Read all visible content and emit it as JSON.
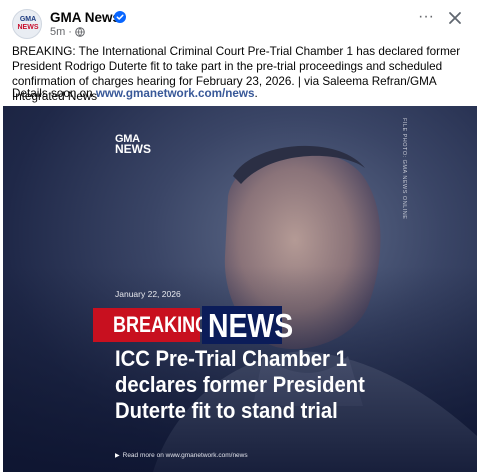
{
  "post": {
    "page_name": "GMA News",
    "time": "5m",
    "privacy_separator": "·",
    "avatar_logo": [
      "GMA",
      "NEWS"
    ],
    "more_label": "···",
    "caption": "BREAKING: The International Criminal Court Pre-Trial Chamber 1 has declared former President Rodrigo Duterte fit to take part in the pre-trial proceedings and scheduled confirmation of charges hearing for February 23, 2026. | via Saleema Refran/GMA Integrated News",
    "details_prefix": "Details soon on ",
    "details_link": "www.gmanetwork.com/news",
    "details_suffix": "."
  },
  "media": {
    "logo_line1": "GMA",
    "logo_line2": "NEWS",
    "photo_credit": "FILE PHOTO: GMA NEWS ONLINE",
    "date": "January 22, 2026",
    "breaking": "BREAKING",
    "news": "NEWS",
    "headline": "ICC Pre-Trial Chamber 1 declares former President Duterte fit to stand trial",
    "readmore": "Read more on www.gmanetwork.com/news"
  },
  "colors": {
    "breaking_red": "#c8101f",
    "news_navy": "#0b1c59",
    "link": "#385898",
    "verified_blue": "#0866ff"
  },
  "icons": [
    "verified-badge-icon",
    "globe-icon",
    "more-options-icon",
    "close-icon",
    "arrow-icon"
  ]
}
